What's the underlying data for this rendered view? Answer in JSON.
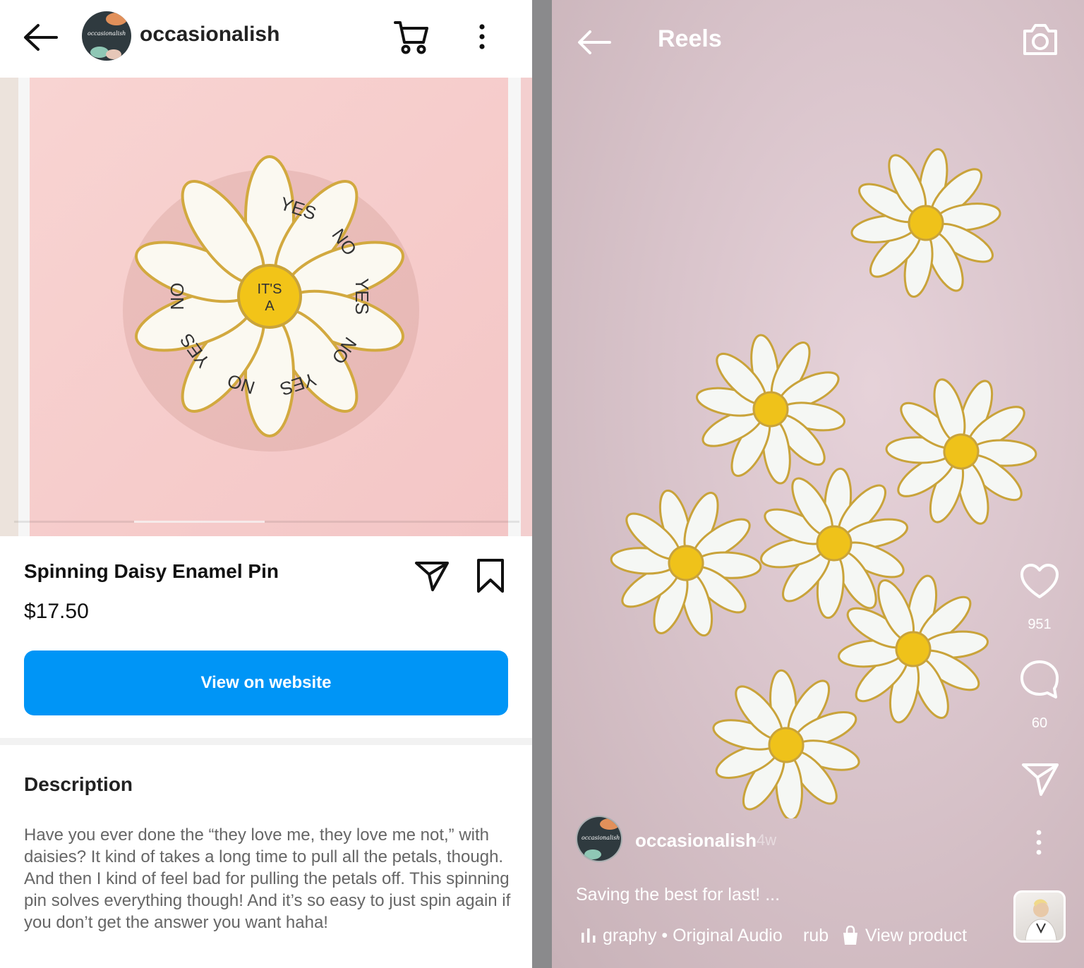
{
  "left": {
    "header": {
      "username": "occasionalish",
      "avatar_logo_text": "occasionalish"
    },
    "product": {
      "title": "Spinning Daisy Enamel Pin",
      "price": "$17.50",
      "cta_label": "View on website"
    },
    "description": {
      "heading": "Description",
      "body": "Have you ever done the “they love me, they love me not,” with daisies? It kind of takes a long time to pull all the petals, though. And then I kind of feel bad for pulling the petals off. This spinning pin solves everything though! And it’s so easy to just spin again if you don’t get the answer you want haha!"
    },
    "pin_labels": [
      "IT'S",
      "A",
      "YES",
      "NO",
      "YES",
      "NO",
      "YES",
      "NO",
      "YES",
      "NO"
    ]
  },
  "right": {
    "header": {
      "title": "Reels"
    },
    "actions": {
      "likes": "951",
      "comments": "60"
    },
    "post": {
      "username": "occasionalish",
      "age": "4w",
      "caption": "Saving the best for last! ...",
      "audio": "graphy • Original Audio",
      "audio_tail": "rub",
      "product_link": "View product"
    }
  },
  "colors": {
    "accent": "#0095f6",
    "pin_center": "#f2c418",
    "pin_gold": "#c9a33a",
    "pink_bg": "#f7cfcd",
    "reel_bg": "#dcc6cd"
  },
  "icons": [
    "arrow-left-icon",
    "cart-icon",
    "more-vertical-icon",
    "send-icon",
    "bookmark-icon",
    "camera-icon",
    "heart-icon",
    "comment-icon",
    "audio-icon",
    "shopping-bag-icon"
  ]
}
